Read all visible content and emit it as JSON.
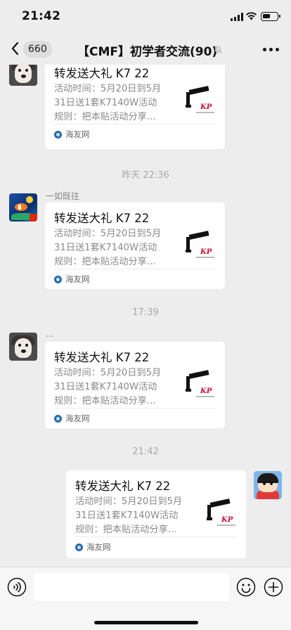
{
  "status": {
    "time": "21:42"
  },
  "nav": {
    "back_count": "660",
    "title": "【CMF】初学者交流(90)"
  },
  "link_card": {
    "title": "转发送大礼 K7 22",
    "description": "活动时间：5月20日到5月\n31日送1套K7140W活动\n规则：把本贴活动分享...",
    "source": "海友网",
    "thumbnail_icon": "product-light-fixture-thumbnail"
  },
  "messages": [
    {
      "sender": "",
      "avatar": "husky-avatar"
    },
    {
      "sender": "一如既往",
      "avatar": "fish-tank-avatar"
    },
    {
      "sender": "...",
      "avatar": "husky-avatar"
    },
    {
      "sender": "",
      "avatar": "cartoon-boy-avatar"
    }
  ],
  "timestamps": [
    "昨天 22:36",
    "17:39",
    "21:42"
  ],
  "input": {
    "value": "",
    "placeholder": "",
    "voice_icon": "voice-icon",
    "emoji_icon": "emoji-icon",
    "plus_icon": "plus-icon"
  },
  "colors": {
    "background": "#ededed",
    "bubble": "#ffffff",
    "secondary_text": "#8a8a8a",
    "thumbnail_red": "#c8102e"
  }
}
